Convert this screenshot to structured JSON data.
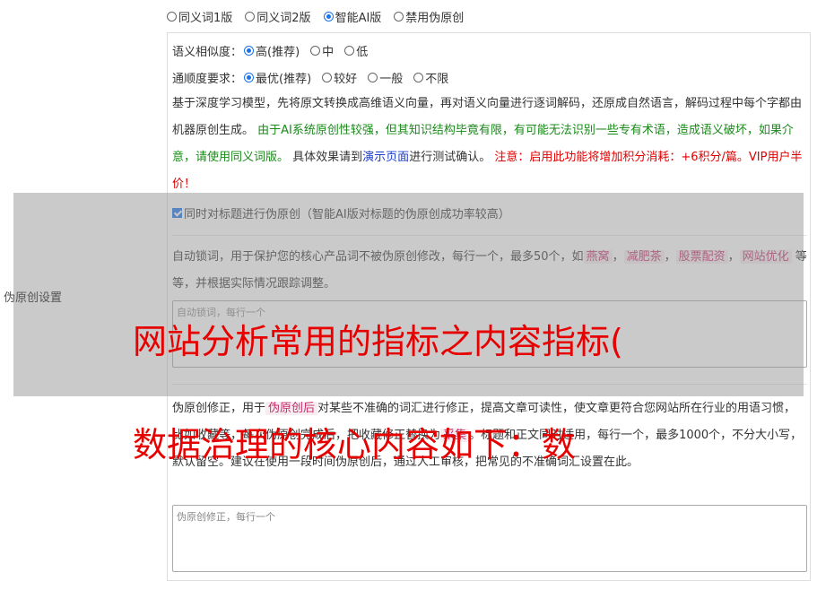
{
  "mode_options": [
    {
      "label": "同义词1版",
      "selected": false
    },
    {
      "label": "同义词2版",
      "selected": false
    },
    {
      "label": "智能AI版",
      "selected": true
    },
    {
      "label": "禁用伪原创",
      "selected": false
    }
  ],
  "similarity": {
    "label": "语义相似度：",
    "options": [
      {
        "label": "高(推荐)",
        "selected": true
      },
      {
        "label": "中",
        "selected": false
      },
      {
        "label": "低",
        "selected": false
      }
    ]
  },
  "fluency": {
    "label": "通顺度要求：",
    "options": [
      {
        "label": "最优(推荐)",
        "selected": true
      },
      {
        "label": "较好",
        "selected": false
      },
      {
        "label": "一般",
        "selected": false
      },
      {
        "label": "不限",
        "selected": false
      }
    ]
  },
  "description": {
    "part1": "基于深度学习模型，先将原文转换成高维语义向量，再对语义向量进行逐词解码，还原成自然语言，解码过程中每个字都由机器原创生成。",
    "part2_green": "由于AI系统原创性较强，但其知识结构毕竟有限，有可能无法识别一些专有术语，造成语义破坏，如果介意，请使用同义词版。",
    "part3": "具体效果请到",
    "link": "演示页面",
    "part4": "进行测试确认。",
    "part5_red": "注意：启用此功能将增加积分消耗：+6积分/篇。VIP用户半价！"
  },
  "sidebar_label": "伪原创设置",
  "title_checkbox": {
    "label": "同时对标题进行伪原创（智能AI版对标题的伪原创成功率较高）",
    "checked": true
  },
  "lock_words": {
    "text1": "自动锁词，用于保护您的核心产品词不被伪原创修改，每行一个，最多50个，如",
    "examples": [
      "燕窝",
      "减肥茶",
      "股票配资",
      "网站优化"
    ],
    "sep": "，",
    "text2": "等等，并根据实际情况跟踪调整。",
    "placeholder": "自动锁词，每行一个"
  },
  "correction": {
    "text1": "伪原创修正，用于",
    "tag": "伪原创后",
    "text2": "对某些不准确的词汇进行修正，提高文章可读性，使文章更符合您网站所在行业的用语习惯，比如",
    "text2b": "收藏",
    "text3": "等，每次伪原创完成后，把",
    "text3b": "收藏",
    "text3c": "修正替换为",
    "text3d": "采集",
    "text4": "。标题和正文同时适用，每行一个，最多1000个，不分大小写，默认留空。建议在使用一段时间伪原创后，通过人工审核，把常见的不准确词汇设置在此。",
    "placeholder": "伪原创修正，每行一个"
  },
  "overlay_headline_1": "网站分析常用的指标之内容指标(",
  "overlay_headline_2": "数据治理的核心内容如下：数"
}
